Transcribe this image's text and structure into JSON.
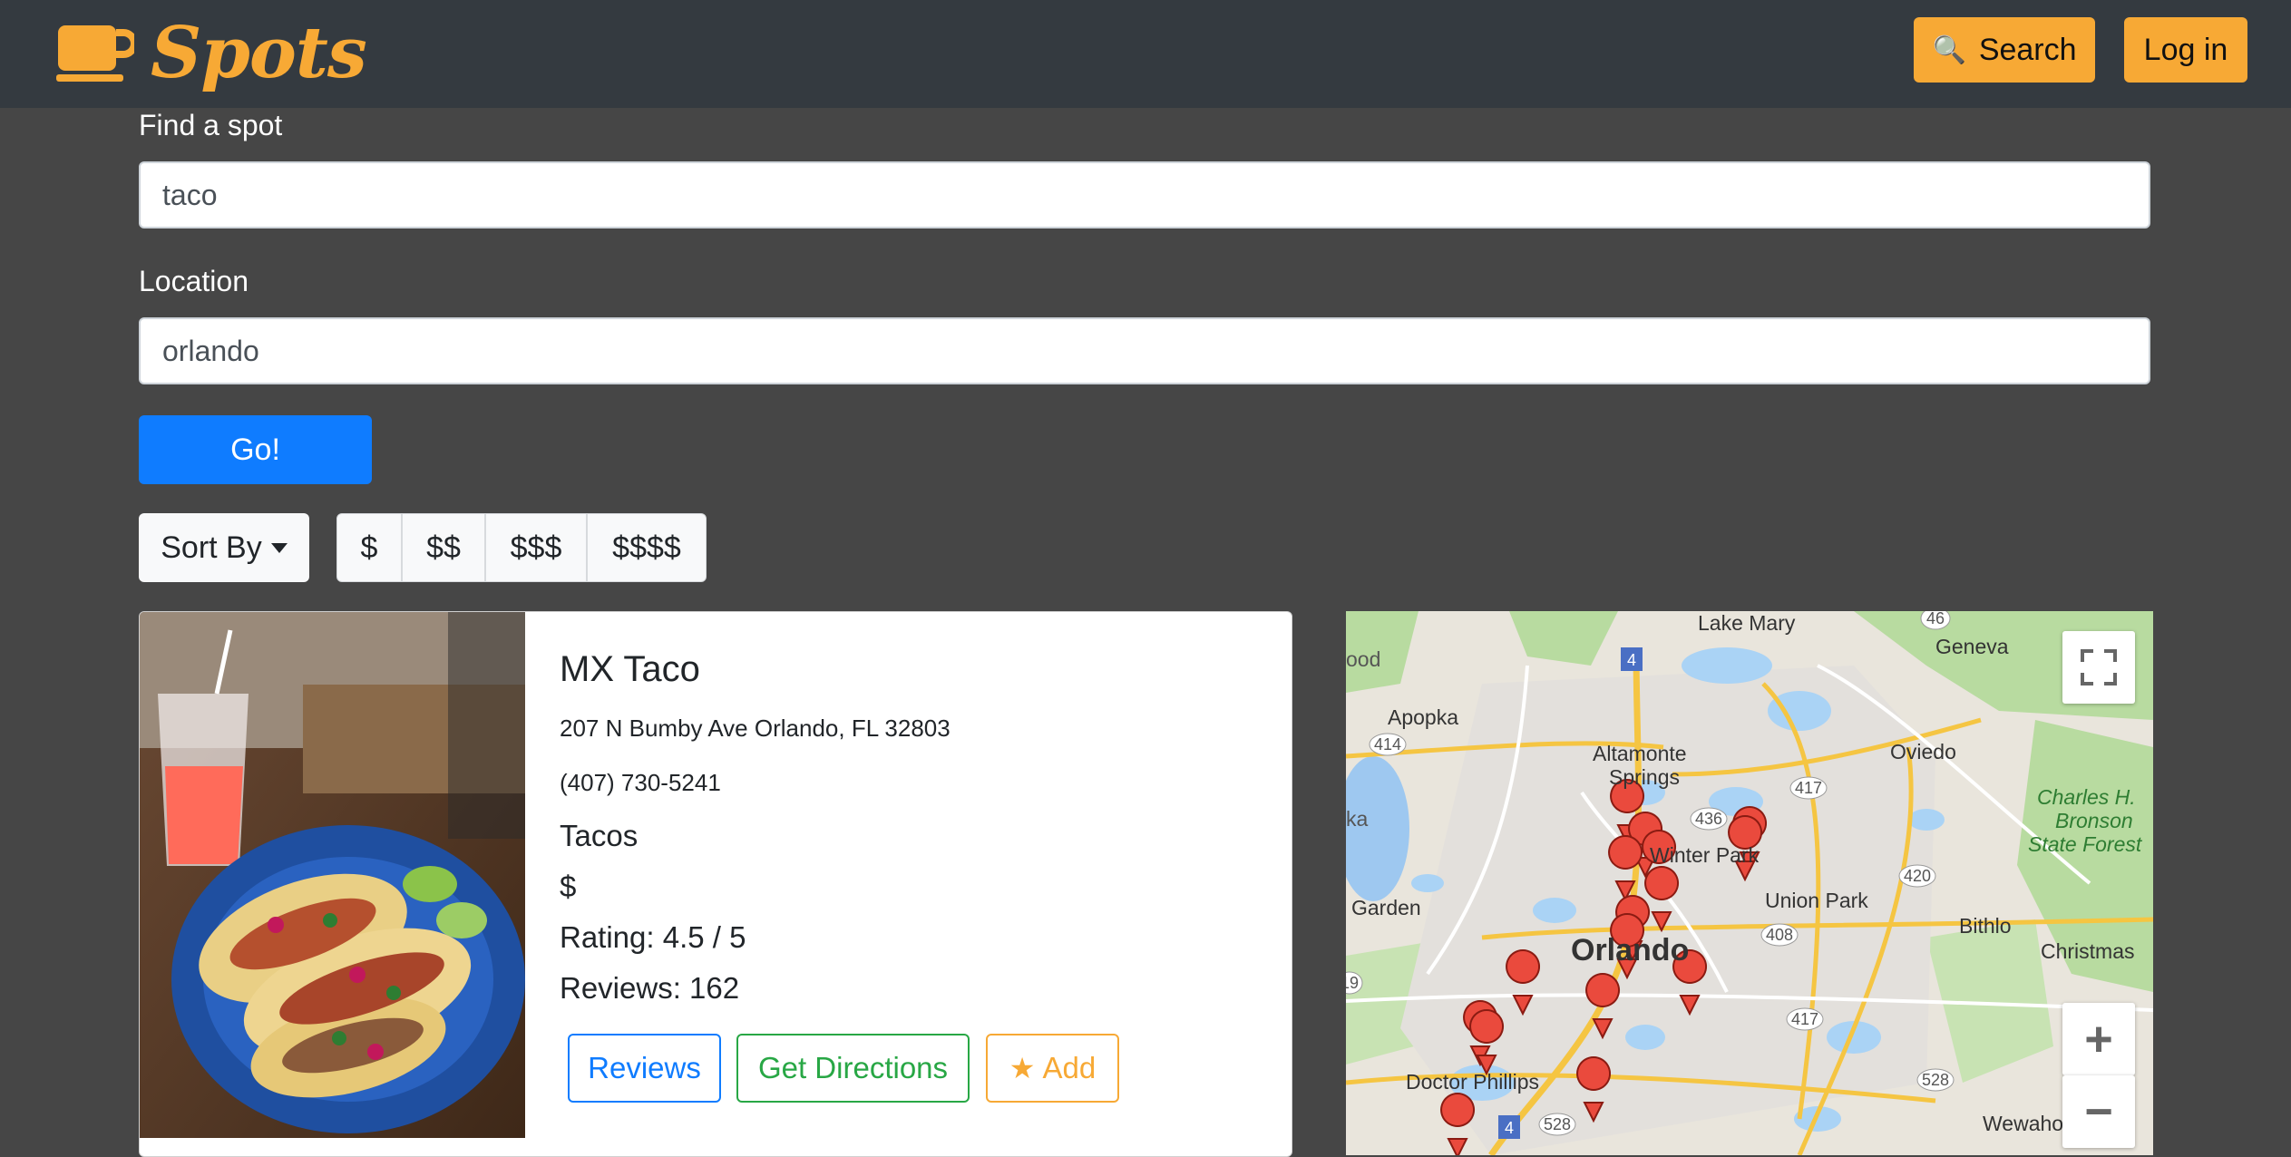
{
  "navbar": {
    "brand": "Spots",
    "search_label": "Search",
    "login_label": "Log in",
    "accent_color": "#f7a935",
    "brand_icon": "coffee-cup-icon",
    "search_icon": "magnifier-icon"
  },
  "search": {
    "find_label": "Find a spot",
    "find_value": "taco",
    "location_label": "Location",
    "location_value": "orlando",
    "go_label": "Go!",
    "sort_label": "Sort By",
    "price_filters": [
      "$",
      "$$",
      "$$$",
      "$$$$"
    ]
  },
  "result": {
    "name": "MX Taco",
    "address": "207 N Bumby Ave Orlando, FL 32803",
    "phone": "(407) 730-5241",
    "category": "Tacos",
    "price": "$",
    "rating": "Rating: 4.5 / 5",
    "reviews": "Reviews: 162",
    "reviews_button": "Reviews",
    "directions_button": "Get Directions",
    "add_button": "Add"
  },
  "map": {
    "places": {
      "lake_mary": "Lake Mary",
      "geneva": "Geneva",
      "apopka": "Apopka",
      "altamonte": "Altamonte",
      "springs": "Springs",
      "oviedo": "Oviedo",
      "winter_park": "Winter Park",
      "union_park": "Union Park",
      "garden": "Garden",
      "bithlo": "Bithlo",
      "christmas": "Christmas",
      "orlando": "Orlando",
      "doctor_phillips": "Doctor Phillips",
      "wewahotee": "Wewahotee",
      "charles_1": "Charles H.",
      "charles_2": "Bronson",
      "charles_3": "State Forest",
      "ood": "ood",
      "ka": "ka"
    },
    "roads": [
      "4",
      "46",
      "414",
      "436",
      "417",
      "420",
      "408",
      "417",
      "528",
      "4",
      "528",
      "19"
    ],
    "fullscreen_icon": "fullscreen-icon",
    "zoom_in": "+",
    "zoom_out": "−"
  }
}
